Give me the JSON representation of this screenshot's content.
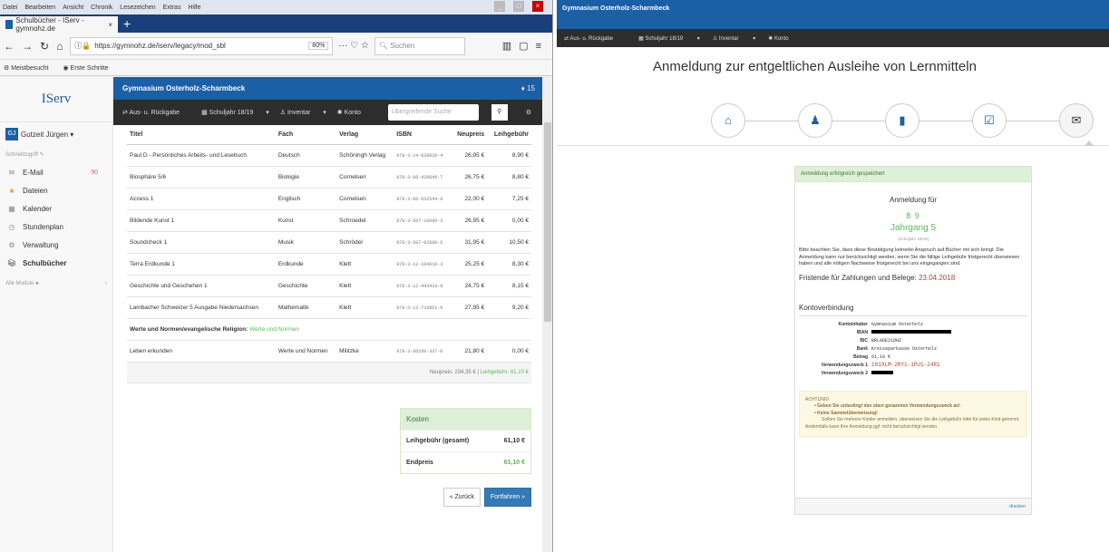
{
  "browser": {
    "menu": [
      "Datei",
      "Bearbeiten",
      "Ansicht",
      "Chronik",
      "Lesezeichen",
      "Extras",
      "Hilfe"
    ],
    "tab_title": "Schulbücher - IServ - gymnohz.de",
    "url": "https://gymnohz.de/iserv/legacy/mod_sbl",
    "zoom": "80%",
    "search_placeholder": "Suchen",
    "bookmarks": [
      "Meistbesucht",
      "Erste Schritte"
    ]
  },
  "iserv": {
    "logo": "IServ",
    "user": "Gutzeit Jürgen",
    "user_initials": "GJ",
    "quick_access": "Schnellzugriff",
    "nav": [
      {
        "label": "E-Mail",
        "count": "90",
        "icon": "mail-icon"
      },
      {
        "label": "Dateien",
        "count": "",
        "icon": "folder-icon"
      },
      {
        "label": "Kalender",
        "count": "",
        "icon": "calendar-icon"
      },
      {
        "label": "Stundenplan",
        "count": "",
        "icon": "clock-icon"
      },
      {
        "label": "Verwaltung",
        "count": "",
        "icon": "gear-icon"
      },
      {
        "label": "Schulbücher",
        "count": "",
        "icon": "books-icon"
      }
    ],
    "all_modules": "Alle Module",
    "school_name": "Gymnasium Osterholz-Scharmbeck",
    "notification_count": "15",
    "topnav": [
      "Aus- u. Rückgabe",
      "Schuljahr 18/19",
      "Inventar",
      "Konto"
    ],
    "global_search": "Übergreifende Suche"
  },
  "books": {
    "columns": [
      "Titel",
      "Fach",
      "Verlag",
      "ISBN",
      "Neupreis",
      "Leihgebühr"
    ],
    "rows": [
      [
        "Paul D - Persönliches Arbeits- und Lesebuch",
        "Deutsch",
        "Schöningh Verlag",
        "978-3-14-028020-4",
        "26,95 €",
        "8,90 €"
      ],
      [
        "Biosphäre 5/6",
        "Biologie",
        "Cornelsen",
        "978-3-06-420046-7",
        "26,75 €",
        "8,80 €"
      ],
      [
        "Access 1",
        "Englisch",
        "Cornelsen",
        "978-3-06-032544-9",
        "22,00 €",
        "7,25 €"
      ],
      [
        "Bildende Kunst 1",
        "Kunst",
        "Schroedel",
        "978-3-507-10080-3",
        "26,95 €",
        "0,00 €"
      ],
      [
        "Soundcheck 1",
        "Musik",
        "Schrödel",
        "978-3-507-02680-6",
        "31,95 €",
        "10,50 €"
      ],
      [
        "Terra Erdkunde 1",
        "Erdkunde",
        "Klett",
        "978-3-12-104610-3",
        "25,25 €",
        "8,30 €"
      ],
      [
        "Geschichte und Geschehen 1",
        "Geschichte",
        "Klett",
        "978-3-12-443410-9",
        "24,75 €",
        "8,15 €"
      ],
      [
        "Lambacher Schweizer 5 Ausgabe Niedersachsen",
        "Mathematik",
        "Klett",
        "978-3-12-733851-9",
        "27,95 €",
        "9,20 €"
      ]
    ],
    "group_label": "Werte und Normen/evangelische Religion:",
    "group_choice": "Werte und Normen",
    "group_rows": [
      [
        "Leben erkunden",
        "Werte und Normen",
        "Militzke",
        "978-3-86189-337-0",
        "21,80 €",
        "0,00 €"
      ]
    ],
    "sum_neupreis": "Neupreis: 234,35 €",
    "sum_leih": "Leihgebühr: 61,10 €"
  },
  "kosten": {
    "title": "Kosten",
    "leih_label": "Leihgebühr (gesamt)",
    "leih_value": "61,10 €",
    "end_label": "Endpreis",
    "end_value": "61,10 €",
    "back": "« Zurück",
    "next": "Fortfahren »"
  },
  "confirm": {
    "school_name": "Gymnasium Osterholz-Scharmbeck",
    "nav": [
      "Aus- u. Rückgabe",
      "Schuljahr 18/19",
      "Inventar",
      "Konto"
    ],
    "title": "Anmeldung zur entgeltlichen Ausleihe von Lernmitteln",
    "success": "Anmeldung erfolgreich gespeichert",
    "anm_for": "Anmeldung für",
    "class": "8 9",
    "jahrgang": "Jahrgang 5",
    "schuljahr": "(Schuljahr 18/19)",
    "note": "Bitte beachten Sie, dass diese Bestätigung keinerlei Anspruch auf Bücher mit sich bringt. Die Anmeldung kann nur berücksichtigt werden, wenn Sie die fällige Leihgebühr fristgerecht überwiesen haben und alle nötigen Nachweise fristgerecht bei uns eingegangen sind.",
    "frist_label": "Fristende für Zahlungen und Belege:",
    "frist_date": "23.04.2018",
    "konto_title": "Kontoverbindung",
    "konto": [
      {
        "k": "Kontoinhaber",
        "v": "Gymnasium Osterholz",
        "redacted": false
      },
      {
        "k": "IBAN",
        "v": "",
        "redacted": true
      },
      {
        "k": "BIC",
        "v": "BRLADE21OHZ",
        "redacted": false
      },
      {
        "k": "Bank",
        "v": "Kreissparkasse Osterholz",
        "redacted": false
      },
      {
        "k": "Betrag",
        "v": "61,10 €",
        "redacted": false
      },
      {
        "k": "Verwendungszweck 1",
        "v": "1819LM-2RY1-1PU1-24R1",
        "redacted": false
      },
      {
        "k": "Verwendungszweck 2",
        "v": "",
        "redacted": true
      }
    ],
    "warn_title": "ACHTUNG!",
    "warn1": "• Geben Sie unbedingt den oben genannten Verwendungszweck an!",
    "warn2": "• Keine Sammelüberweisung!",
    "warn3": "Sollten Sie mehrere Kinder anmelden, überweisen Sie die Leihgebühr bitte für jedes Kind getrennt.",
    "warn4": "Andernfalls kann Ihre Anmeldung ggf. nicht berücksichtigt werden.",
    "print": "drucken"
  },
  "colors": {
    "iserv_blue": "#1b5fa6",
    "success_green": "#5cb85c",
    "dark_nav": "#2d2d2d"
  }
}
